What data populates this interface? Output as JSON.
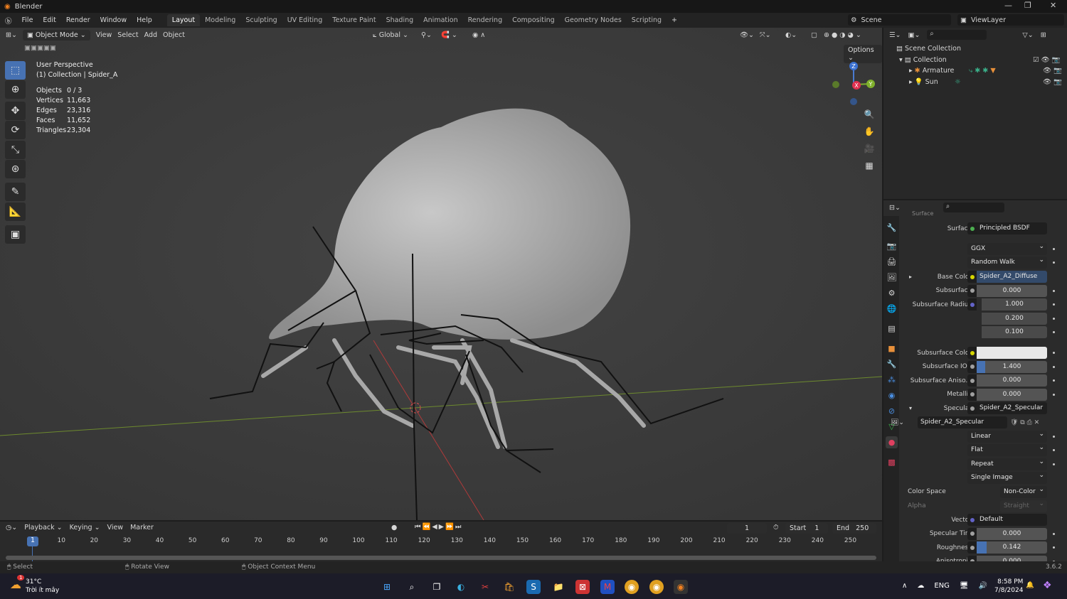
{
  "app": {
    "title": "Blender",
    "version": "3.6.2"
  },
  "menu": [
    "File",
    "Edit",
    "Render",
    "Window",
    "Help"
  ],
  "workspaces": [
    {
      "label": "Layout",
      "active": true
    },
    {
      "label": "Modeling"
    },
    {
      "label": "Sculpting"
    },
    {
      "label": "UV Editing"
    },
    {
      "label": "Texture Paint"
    },
    {
      "label": "Shading"
    },
    {
      "label": "Animation"
    },
    {
      "label": "Rendering"
    },
    {
      "label": "Compositing"
    },
    {
      "label": "Geometry Nodes"
    },
    {
      "label": "Scripting"
    }
  ],
  "scene": {
    "scene_name": "Scene",
    "view_layer": "ViewLayer"
  },
  "viewport": {
    "mode": "Object Mode",
    "menus": [
      "View",
      "Select",
      "Add",
      "Object"
    ],
    "orientation": "Global",
    "options_label": "Options",
    "view_name": "User Perspective",
    "collection_path": "(1) Collection | Spider_A",
    "stats": [
      {
        "label": "Objects",
        "value": "0 / 3"
      },
      {
        "label": "Vertices",
        "value": "11,663"
      },
      {
        "label": "Edges",
        "value": "23,316"
      },
      {
        "label": "Faces",
        "value": "11,652"
      },
      {
        "label": "Triangles",
        "value": "23,304"
      }
    ],
    "gizmo": {
      "z": "Z",
      "x": "X",
      "y": "Y"
    }
  },
  "outliner": {
    "items": [
      {
        "label": "Scene Collection"
      },
      {
        "label": "Collection"
      },
      {
        "label": "Armature"
      },
      {
        "label": "Sun"
      }
    ]
  },
  "properties": {
    "section": "Surface",
    "rows": [
      {
        "label": "Surface",
        "type": "link",
        "socket": "#4caf50",
        "value": "Principled BSDF"
      },
      {
        "type": "dd",
        "value": "GGX",
        "gap": true,
        "dot": true
      },
      {
        "type": "dd",
        "value": "Random Walk",
        "dot": true
      },
      {
        "label": "Base Color",
        "type": "link",
        "socket": "#d6d600",
        "value": "Spider_A2_Diffuse",
        "arrow": "▸",
        "hl": true
      },
      {
        "label": "Subsurface",
        "type": "num",
        "socket": "#a0a0a0",
        "value": "0.000",
        "fill": 0,
        "dot": true
      },
      {
        "label": "Subsurface Radius",
        "type": "num",
        "socket": "#6363c7",
        "value": "1.000",
        "dot": true,
        "vec": true
      },
      {
        "type": "num",
        "value": "0.200",
        "dot": true,
        "vec": true
      },
      {
        "type": "num",
        "value": "0.100",
        "dot": true,
        "vec": true
      },
      {
        "label": "Subsurface Color",
        "type": "color",
        "socket": "#d6d600",
        "value": "",
        "dot": true,
        "gap": true
      },
      {
        "label": "Subsurface IOR",
        "type": "num",
        "socket": "#a0a0a0",
        "value": "1.400",
        "fill": 0.12,
        "dot": true
      },
      {
        "label": "Subsurface Aniso...",
        "type": "num",
        "socket": "#a0a0a0",
        "value": "0.000",
        "fill": 0,
        "dot": true
      },
      {
        "label": "Metallic",
        "type": "num",
        "socket": "#a0a0a0",
        "value": "0.000",
        "fill": 0,
        "dot": true
      },
      {
        "label": "Specular",
        "type": "link",
        "socket": "#a0a0a0",
        "value": "Spider_A2_Specular",
        "arrow": "▾"
      },
      {
        "type": "image",
        "value": "Spider_A2_Specular"
      },
      {
        "type": "dd",
        "value": "Linear",
        "dot": true
      },
      {
        "type": "dd",
        "value": "Flat",
        "dot": true
      },
      {
        "type": "dd",
        "value": "Repeat",
        "dot": true
      },
      {
        "type": "dd",
        "value": "Single Image"
      },
      {
        "label": "Color Space",
        "type": "dd2",
        "value": "Non-Color",
        "leftlabel": true
      },
      {
        "label": "Alpha",
        "type": "dd2",
        "value": "Straight",
        "leftlabel": true,
        "disabled": true
      },
      {
        "label": "Vector",
        "type": "link",
        "socket": "#6363c7",
        "value": "Default"
      },
      {
        "label": "Specular Tint",
        "type": "num",
        "socket": "#a0a0a0",
        "value": "0.000",
        "fill": 0,
        "dot": true
      },
      {
        "label": "Roughness",
        "type": "num",
        "socket": "#a0a0a0",
        "value": "0.142",
        "fill": 0.142,
        "dot": true
      },
      {
        "label": "Anisotropic",
        "type": "num",
        "socket": "#a0a0a0",
        "value": "0.000",
        "fill": 0,
        "dot": true
      }
    ]
  },
  "timeline": {
    "menus": [
      "Playback",
      "Keying",
      "View",
      "Marker"
    ],
    "current_frame": "1",
    "start_label": "Start",
    "start": "1",
    "end_label": "End",
    "end": "250",
    "ticks": [
      "10",
      "20",
      "30",
      "40",
      "50",
      "60",
      "70",
      "80",
      "90",
      "100",
      "110",
      "120",
      "130",
      "140",
      "150",
      "160",
      "170",
      "180",
      "190",
      "200",
      "210",
      "220",
      "230",
      "240",
      "250"
    ]
  },
  "statusbar": {
    "items": [
      "Select",
      "Rotate View",
      "Object Context Menu"
    ]
  },
  "taskbar": {
    "weather_temp": "31°C",
    "weather_desc": "Trời ít mây",
    "lang": "ENG",
    "time": "8:58 PM",
    "date": "7/8/2024",
    "notification_badge": "1"
  }
}
